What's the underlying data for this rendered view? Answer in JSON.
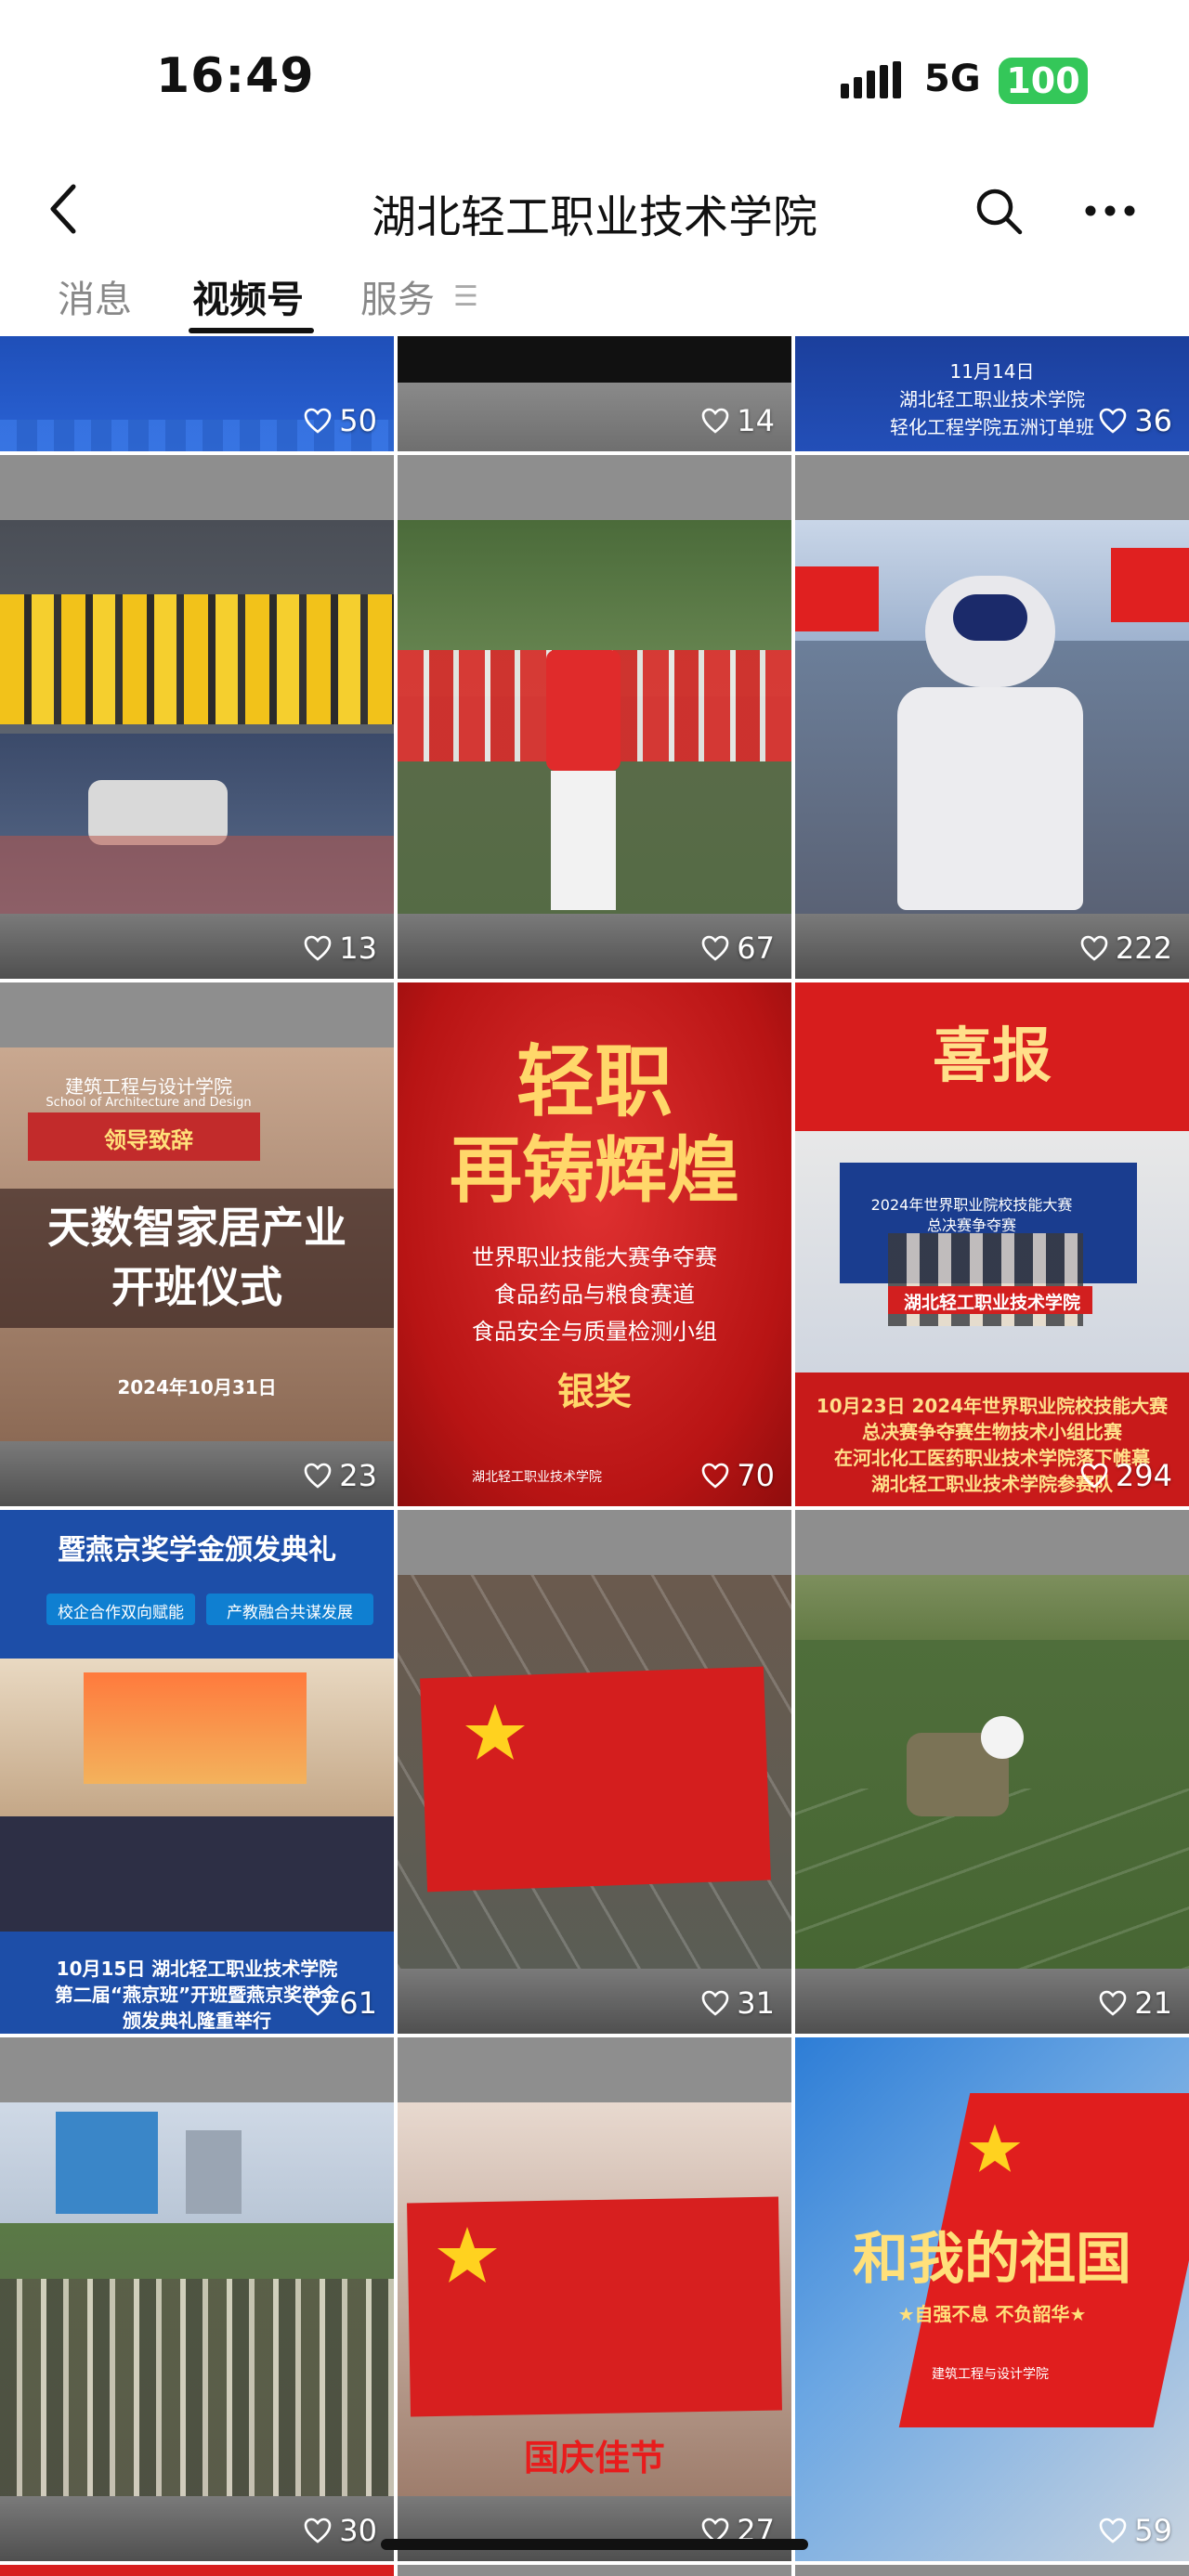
{
  "status_bar": {
    "time": "16:49",
    "network": "5G",
    "battery": "100"
  },
  "header": {
    "title": "湖北轻工职业技术学院"
  },
  "tabs": [
    {
      "label": "消息",
      "active": false
    },
    {
      "label": "视频号",
      "active": true
    },
    {
      "label": "服务",
      "active": false
    }
  ],
  "videos": [
    {
      "likes": "50",
      "lines": []
    },
    {
      "likes": "14",
      "lines": []
    },
    {
      "likes": "36",
      "lines": [
        "11月14日",
        "湖北轻工职业技术学院",
        "轻化工程学院五洲订单班"
      ]
    },
    {
      "likes": "13",
      "lines": []
    },
    {
      "likes": "67",
      "lines": []
    },
    {
      "likes": "222",
      "lines": []
    },
    {
      "likes": "23",
      "lines": [
        "建筑工程与设计学院",
        "School of Architecture and Design",
        "领导致辞",
        "天数智家居产业",
        "开班仪式",
        "2024年10月31日"
      ]
    },
    {
      "likes": "70",
      "lines": [
        "轻职",
        "再铸辉煌",
        "世界职业技能大赛争夺赛",
        "食品药品与粮食赛道",
        "食品安全与质量检测小组",
        "银奖",
        "湖北轻工职业技术学院"
      ]
    },
    {
      "likes": "294",
      "lines": [
        "喜报",
        "2024年世界职业院校技能大赛",
        "总决赛争夺赛",
        "湖北轻工职业技术学院",
        "10月23日 2024年世界职业院校技能大赛",
        "总决赛争夺赛生物技术小组比赛",
        "在河北化工医药职业技术学院落下帷幕",
        "湖北轻工职业技术学院参赛队"
      ]
    },
    {
      "likes": "61",
      "lines": [
        "暨燕京奖学金颁发典礼",
        "校企合作双向赋能",
        "产教融合共谋发展",
        "10月15日 湖北轻工职业技术学院",
        "第二届“燕京班”开班暨燕京奖学金",
        "颁发典礼隆重举行"
      ]
    },
    {
      "likes": "31",
      "lines": []
    },
    {
      "likes": "21",
      "lines": []
    },
    {
      "likes": "30",
      "lines": []
    },
    {
      "likes": "27",
      "lines": [
        "国庆佳节"
      ]
    },
    {
      "likes": "59",
      "lines": [
        "和我的祖国",
        "★自强不息 不负韶华★",
        "建筑工程与设计学院"
      ]
    }
  ],
  "colors": {
    "accent_battery": "#34c759",
    "red_banner": "#d81e1e",
    "navy_banner": "#1a3d8f"
  }
}
